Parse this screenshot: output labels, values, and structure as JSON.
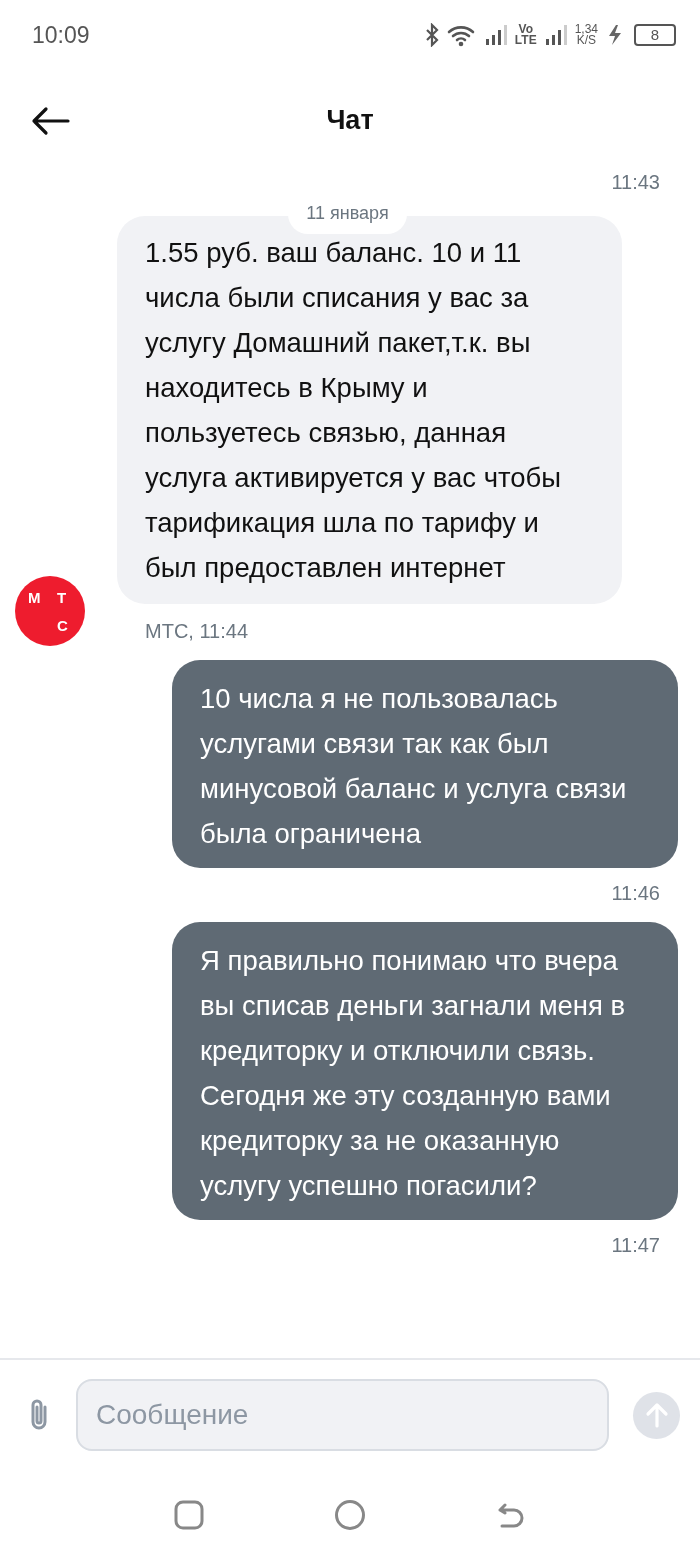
{
  "status_bar": {
    "time": "10:09",
    "volte_top": "Vo",
    "volte_bottom": "LTE",
    "speed": "1,34",
    "speed_unit": "K/S",
    "battery": "8"
  },
  "header": {
    "title": "Чат"
  },
  "earlier_time": "11:43",
  "date_separator": "11 января",
  "messages": [
    {
      "kind": "incoming",
      "text": "1.55 руб. ваш баланс. 10 и 11 числа были списания у вас за услугу Домашний пакет,т.к. вы находитесь в Крыму и пользуетесь связью, данная услуга активируется у вас чтобы тарификация шла по тарифу и был предоставлен интернет",
      "meta": "МТС, 11:44",
      "avatar": {
        "letters": [
          "М",
          "Т",
          "С"
        ]
      }
    },
    {
      "kind": "outgoing",
      "text": "10 числа я не пользовалась услугами связи так как был минусовой баланс и услуга связи была ограничена",
      "meta": "11:46"
    },
    {
      "kind": "outgoing",
      "text": "Я правильно понимаю что вчера вы списав деньги загнали меня в кредиторку и отключили связь. Сегодня же эту созданную вами кредиторку за не оказанную услугу успешно погасили?",
      "meta": "11:47"
    }
  ],
  "composer": {
    "placeholder": "Сообщение"
  }
}
